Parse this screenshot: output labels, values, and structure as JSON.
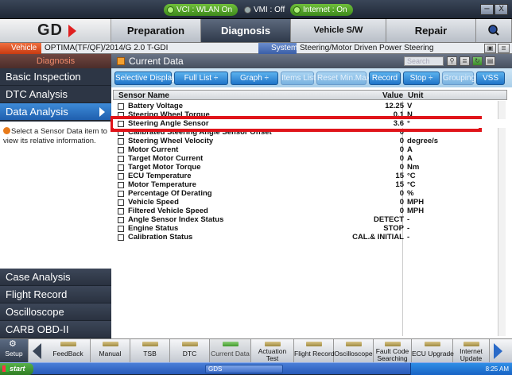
{
  "status_bar": {
    "vci": "VCI : WLAN On",
    "vmi": "VMI : Off",
    "internet": "Internet : On",
    "window_buttons": [
      "−",
      "X"
    ]
  },
  "logo": "GD",
  "top_tabs": [
    {
      "label": "Preparation",
      "active": false
    },
    {
      "label": "Diagnosis",
      "active": true
    },
    {
      "label": "Vehicle S/W Management",
      "active": false
    },
    {
      "label": "Repair",
      "active": false
    }
  ],
  "vehicle_row": {
    "vehicle_label": "Vehicle",
    "vehicle_value": "OPTIMA(TF/QF)/2014/G 2.0 T-GDI",
    "system_label": "System",
    "system_value": "Steering/Motor Driven Power Steering"
  },
  "left_panel": {
    "header": "Diagnosis",
    "items": [
      "Basic Inspection",
      "DTC Analysis",
      "Data Analysis"
    ],
    "selected": "Data Analysis",
    "info_text": "Select a Sensor Data item to view its relative information.",
    "bottom_items": [
      "Case Analysis",
      "Flight Record",
      "Oscilloscope",
      "CARB OBD-II"
    ]
  },
  "main": {
    "header": "Current Data",
    "search_placeholder": "Search",
    "toolbar": [
      {
        "label": "Selective Display ÷",
        "enabled": true
      },
      {
        "label": "Full List ÷",
        "enabled": true
      },
      {
        "label": "Graph ÷",
        "enabled": true
      },
      {
        "label": "Items List ÷",
        "enabled": false
      },
      {
        "label": "Reset Min.Max",
        "enabled": false
      },
      {
        "label": "Record",
        "enabled": true
      },
      {
        "label": "Stop ÷",
        "enabled": true
      },
      {
        "label": "Grouping",
        "enabled": false
      },
      {
        "label": "VSS",
        "enabled": true
      }
    ],
    "columns": [
      "Sensor Name",
      "Value",
      "Unit"
    ],
    "rows": [
      {
        "name": "Battery Voltage",
        "value": "12.25",
        "unit": "V"
      },
      {
        "name": "Steering Wheel Torque",
        "value": "0.1",
        "unit": "N"
      },
      {
        "name": "Steering Angle Sensor",
        "value": "3.6",
        "unit": "°",
        "highlighted": true
      },
      {
        "name": "Calibrated Steering Angle Sensor Offset",
        "value": "0",
        "unit": ""
      },
      {
        "name": "Steering Wheel Velocity",
        "value": "0",
        "unit": "degree/s"
      },
      {
        "name": "Motor Current",
        "value": "0",
        "unit": "A"
      },
      {
        "name": "Target Motor Current",
        "value": "0",
        "unit": "A"
      },
      {
        "name": "Target Motor Torque",
        "value": "0",
        "unit": "Nm"
      },
      {
        "name": "ECU Temperature",
        "value": "15",
        "unit": "°C"
      },
      {
        "name": "Motor Temperature",
        "value": "15",
        "unit": "°C"
      },
      {
        "name": "Percentage Of Derating",
        "value": "0",
        "unit": "%"
      },
      {
        "name": "Vehicle Speed",
        "value": "0",
        "unit": "MPH"
      },
      {
        "name": "Filtered Vehicle Speed",
        "value": "0",
        "unit": "MPH"
      },
      {
        "name": "Angle Sensor Index Status",
        "value": "DETECT",
        "unit": "-"
      },
      {
        "name": "Engine Status",
        "value": "STOP",
        "unit": "-"
      },
      {
        "name": "Calibration Status",
        "value": "CAL.& INITIAL",
        "unit": "-"
      }
    ]
  },
  "bottom_toolbar": {
    "setup": "Setup",
    "buttons": [
      "FeedBack",
      "Manual",
      "TSB",
      "DTC",
      "Current Data",
      "Actuation Test",
      "Flight Record",
      "Oscilloscope",
      "Fault Code Searching",
      "ECU Upgrade",
      "Internet Update"
    ],
    "current": "Current Data"
  },
  "taskbar": {
    "start": "start",
    "task": "GDS",
    "clock": "8:25 AM"
  }
}
